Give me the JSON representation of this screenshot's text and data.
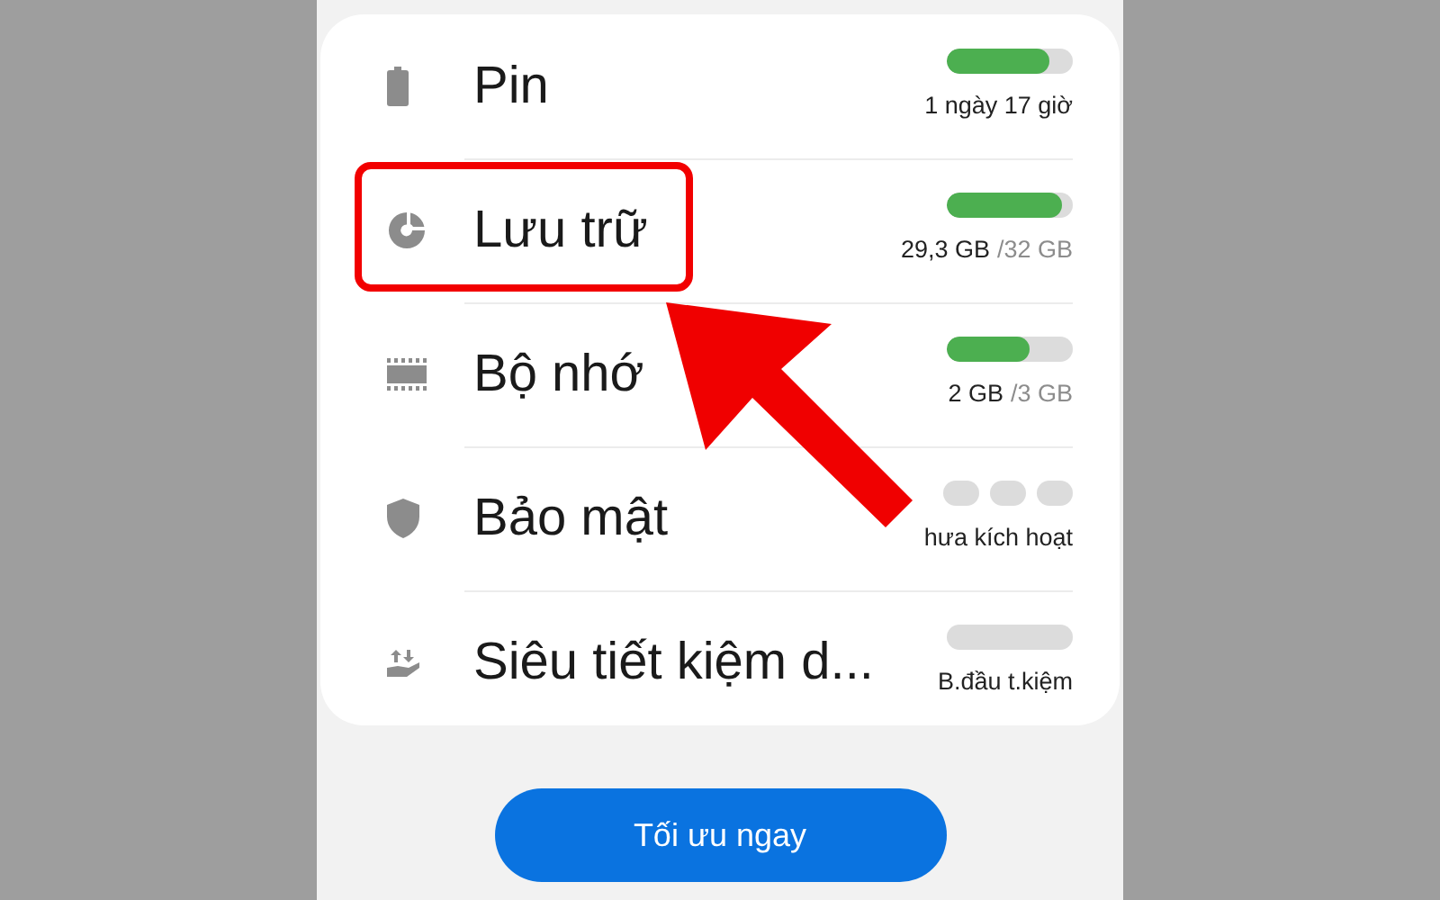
{
  "items": [
    {
      "title": "Pin",
      "kind": "bar",
      "level": 0.81,
      "value": "1 ngày 17 giờ",
      "highlighted": false
    },
    {
      "title": "Lưu trữ",
      "kind": "bar",
      "level": 0.91,
      "value": "29,3 GB",
      "total": "/32 GB",
      "highlighted": true
    },
    {
      "title": "Bộ nhớ",
      "kind": "bar",
      "level": 0.65,
      "value": "2 GB",
      "total": "/3 GB",
      "highlighted": false
    },
    {
      "title": "Bảo mật",
      "kind": "dots",
      "value": "hưa kích hoạt",
      "highlighted": false
    },
    {
      "title": "Siêu tiết kiệm d...",
      "kind": "bar",
      "value": "B.đầu t.kiệm",
      "highlighted": false
    }
  ],
  "button": "Tối ưu ngay"
}
